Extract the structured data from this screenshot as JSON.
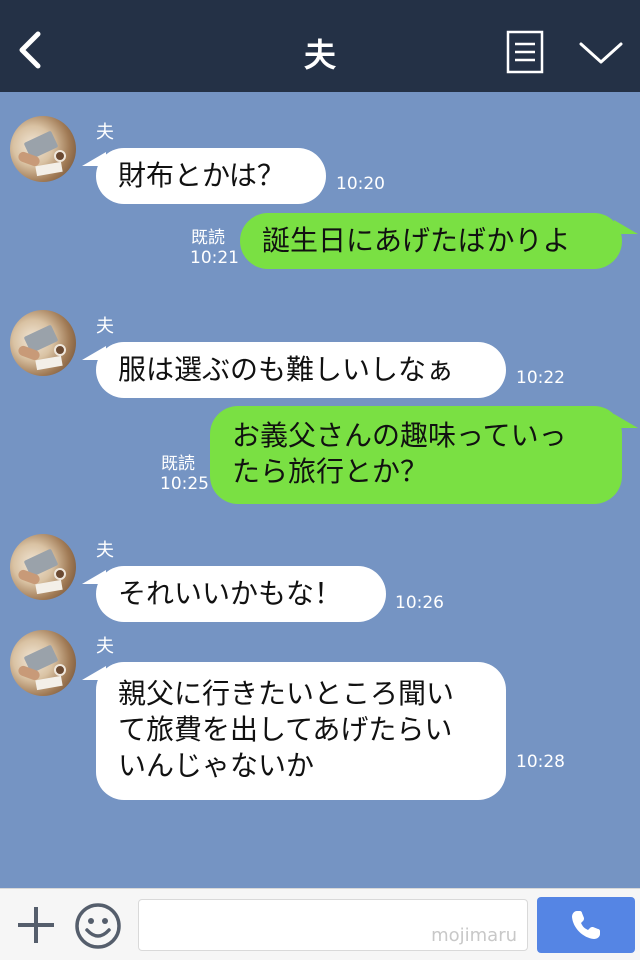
{
  "header": {
    "title": "夫"
  },
  "messages": [
    {
      "sender": "夫",
      "text": "財布とかは？",
      "time": "10:20"
    },
    {
      "read": "既読",
      "time": "10:21",
      "text": "誕生日にあげたばかりよ"
    },
    {
      "sender": "夫",
      "text": "服は選ぶのも難しいしなぁ",
      "time": "10:22"
    },
    {
      "read": "既読",
      "time": "10:25",
      "text": "お義父さんの趣味っていっ\nたら旅行とか？"
    },
    {
      "sender": "夫",
      "text": "それいいかもな！",
      "time": "10:26"
    },
    {
      "sender": "夫",
      "text": "親父に行きたいところ聞い\nて旅費を出してあげたらい\nいんじゃないか",
      "time": "10:28"
    }
  ],
  "footer": {
    "watermark": "mojimaru"
  },
  "colors": {
    "header_bg": "#243146",
    "chat_bg": "#7594c3",
    "sent_bubble": "#7ae043",
    "received_bubble": "#ffffff",
    "call_button": "#5585e4"
  },
  "icons": [
    "back-icon",
    "menu-icon",
    "collapse-icon",
    "plus-icon",
    "smile-icon",
    "phone-icon"
  ]
}
